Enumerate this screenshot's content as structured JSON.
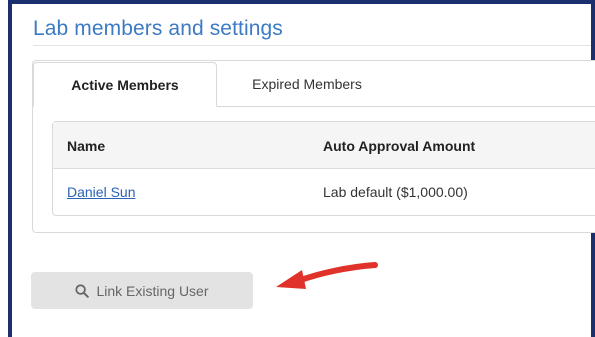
{
  "panel": {
    "title": "Lab members and settings"
  },
  "tabs": [
    {
      "label": "Active Members",
      "active": true
    },
    {
      "label": "Expired Members",
      "active": false
    }
  ],
  "table": {
    "columns": [
      "Name",
      "Auto Approval Amount"
    ],
    "rows": [
      {
        "name": "Daniel Sun",
        "auto_approval": "Lab default ($1,000.00)"
      }
    ]
  },
  "actions": {
    "link_existing_user": "Link Existing User",
    "icon": "search-icon"
  },
  "colors": {
    "frame": "#1b2f6e",
    "title": "#3c7ac4",
    "link": "#2a62b4",
    "button_bg": "#e3e3e3",
    "annotation_arrow": "#e0322a"
  }
}
